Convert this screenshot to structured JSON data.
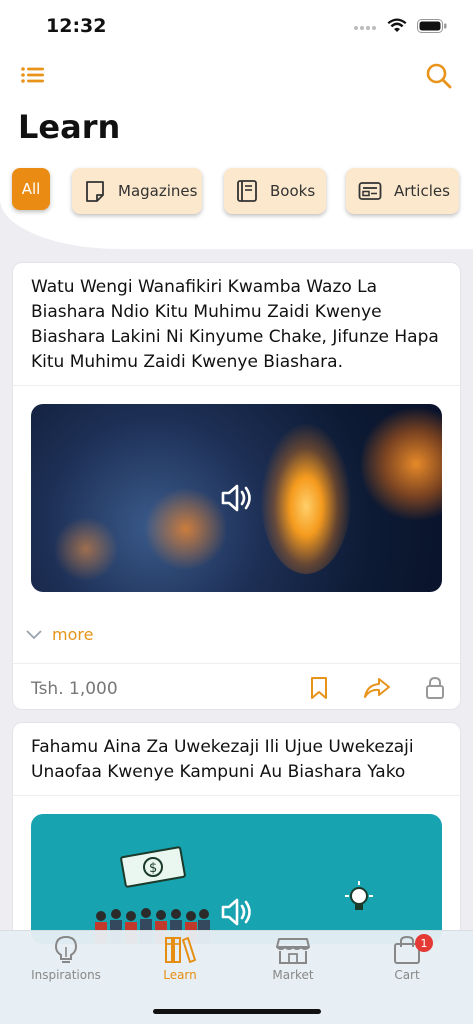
{
  "status_bar": {
    "time": "12:32"
  },
  "header": {
    "title": "Learn"
  },
  "filters": [
    {
      "label": "All",
      "icon": "none",
      "active": true
    },
    {
      "label": "Magazines",
      "icon": "magazine-icon",
      "active": false
    },
    {
      "label": "Books",
      "icon": "book-icon",
      "active": false
    },
    {
      "label": "Articles",
      "icon": "article-icon",
      "active": false
    }
  ],
  "cards": [
    {
      "title": "Watu Wengi Wanafikiri Kwamba Wazo La Biashara Ndio Kitu Muhimu Zaidi Kwenye Biashara Lakini Ni Kinyume Chake, Jifunze Hapa Kitu Muhimu Zaidi Kwenye Biashara.",
      "more_label": "more",
      "price": "Tsh. 1,000"
    },
    {
      "title": "Fahamu Aina Za Uwekezaji Ili Ujue Uwekezaji Unaofaa Kwenye Kampuni Au Biashara Yako"
    }
  ],
  "tabs": [
    {
      "label": "Inspirations",
      "icon": "lightbulb-icon",
      "active": false
    },
    {
      "label": "Learn",
      "icon": "library-icon",
      "active": true
    },
    {
      "label": "Market",
      "icon": "store-icon",
      "active": false
    },
    {
      "label": "Cart",
      "icon": "bag-icon",
      "active": false,
      "badge": "1"
    }
  ],
  "colors": {
    "accent": "#ea8c14",
    "chip_bg": "#fbe8cd",
    "teal": "#18a3b0"
  }
}
